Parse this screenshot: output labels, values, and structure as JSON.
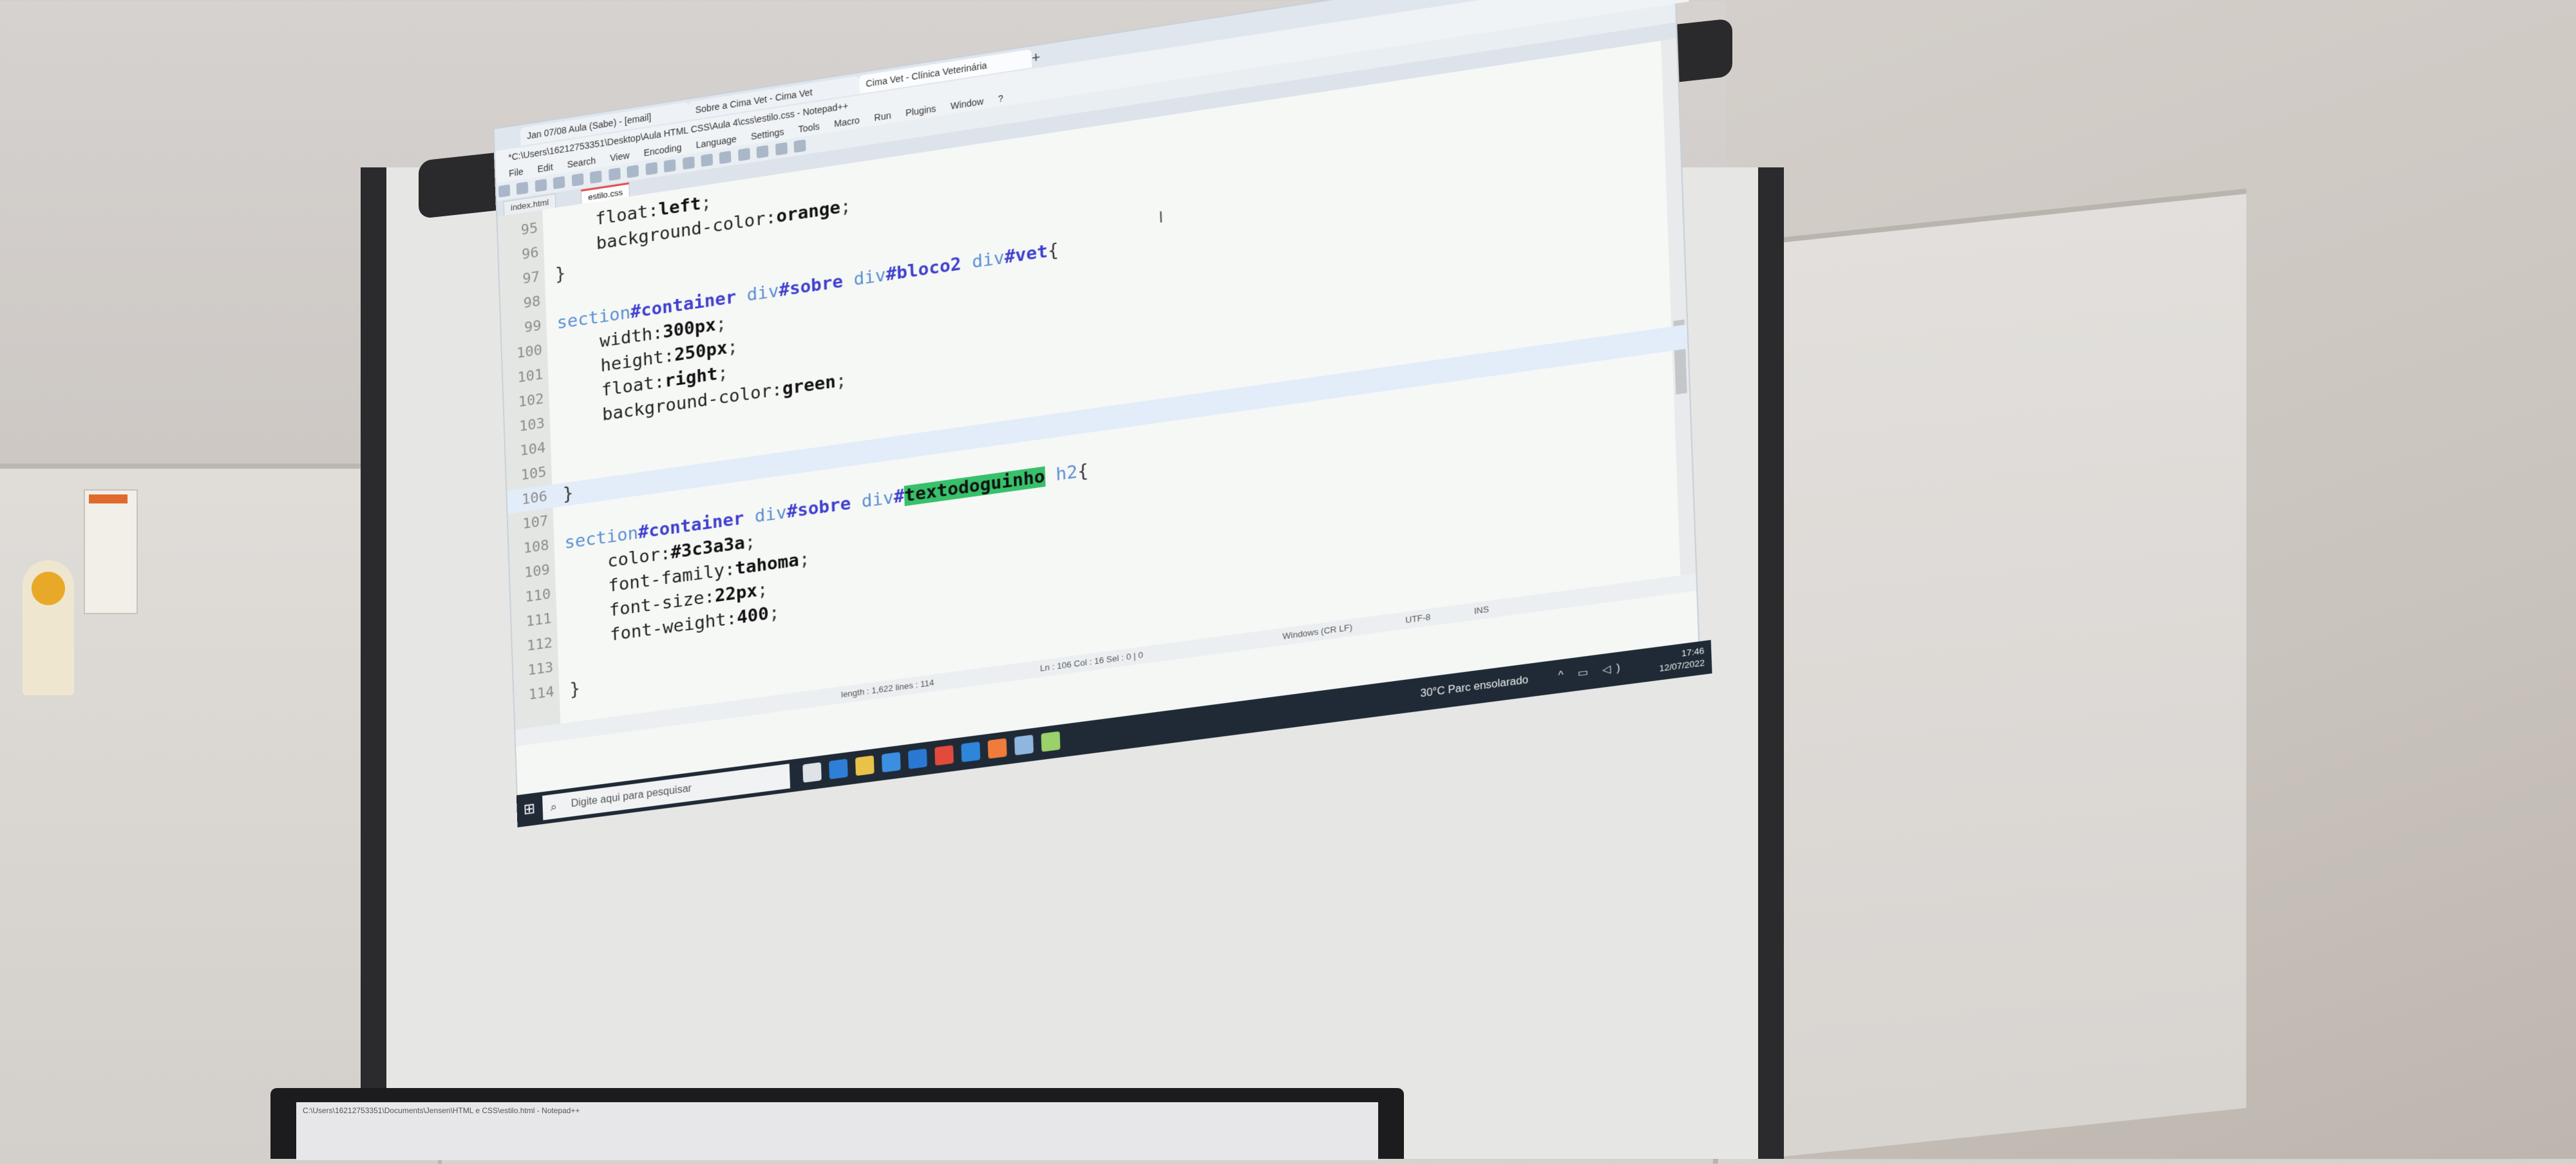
{
  "browser": {
    "tabs": [
      "Jan 07/08 Aula (Sabe) - [email]",
      "Sobre a Cima Vet - Cima Vet",
      "Cima Vet - Clínica Veterinária"
    ],
    "new_tab": "+",
    "controls": "–  ▢  ✕"
  },
  "editor": {
    "title": "*C:\\Users\\16212753351\\Desktop\\Aula HTML CSS\\Aula 4\\css\\estilo.css - Notepad++",
    "menu": [
      "File",
      "Edit",
      "Search",
      "View",
      "Encoding",
      "Language",
      "Settings",
      "Tools",
      "Macro",
      "Run",
      "Plugins",
      "Window",
      "?"
    ],
    "doc_tabs": [
      "index.html",
      "estilo.css"
    ],
    "lines": [
      {
        "n": "95",
        "parts": [
          {
            "t": "    float:",
            "c": "prop"
          },
          {
            "t": "left",
            "c": "val"
          },
          {
            "t": ";",
            "c": "ops"
          }
        ]
      },
      {
        "n": "96",
        "parts": [
          {
            "t": "    background-color:",
            "c": "prop"
          },
          {
            "t": "orange",
            "c": "val"
          },
          {
            "t": ";",
            "c": "ops"
          }
        ]
      },
      {
        "n": "97",
        "parts": [
          {
            "t": "}",
            "c": "ops"
          }
        ]
      },
      {
        "n": "98",
        "parts": []
      },
      {
        "n": "99",
        "parts": [
          {
            "t": "section",
            "c": "kw"
          },
          {
            "t": "#container",
            "c": "sel"
          },
          {
            "t": " div",
            "c": "kw"
          },
          {
            "t": "#sobre",
            "c": "sel"
          },
          {
            "t": " div",
            "c": "kw"
          },
          {
            "t": "#bloco2",
            "c": "sel"
          },
          {
            "t": " div",
            "c": "kw"
          },
          {
            "t": "#vet",
            "c": "sel"
          },
          {
            "t": "{",
            "c": "ops"
          }
        ]
      },
      {
        "n": "100",
        "parts": [
          {
            "t": "    width:",
            "c": "prop"
          },
          {
            "t": "300px",
            "c": "val"
          },
          {
            "t": ";",
            "c": "ops"
          }
        ]
      },
      {
        "n": "101",
        "parts": [
          {
            "t": "    height:",
            "c": "prop"
          },
          {
            "t": "250px",
            "c": "val"
          },
          {
            "t": ";",
            "c": "ops"
          }
        ]
      },
      {
        "n": "102",
        "parts": [
          {
            "t": "    float:",
            "c": "prop"
          },
          {
            "t": "right",
            "c": "val"
          },
          {
            "t": ";",
            "c": "ops"
          }
        ]
      },
      {
        "n": "103",
        "parts": [
          {
            "t": "    background-color:",
            "c": "prop"
          },
          {
            "t": "green",
            "c": "val"
          },
          {
            "t": ";",
            "c": "ops"
          }
        ]
      },
      {
        "n": "104",
        "parts": []
      },
      {
        "n": "105",
        "parts": []
      },
      {
        "n": "106",
        "parts": [
          {
            "t": "}",
            "c": "ops"
          }
        ]
      },
      {
        "n": "107",
        "parts": []
      },
      {
        "n": "108",
        "parts": [
          {
            "t": "section",
            "c": "kw"
          },
          {
            "t": "#container",
            "c": "sel"
          },
          {
            "t": " div",
            "c": "kw"
          },
          {
            "t": "#sobre",
            "c": "sel"
          },
          {
            "t": " div",
            "c": "kw"
          },
          {
            "t": "#",
            "c": "sel"
          },
          {
            "t": "textodoguinho",
            "c": "match"
          },
          {
            "t": " h2",
            "c": "kw"
          },
          {
            "t": "{",
            "c": "ops"
          }
        ]
      },
      {
        "n": "109",
        "parts": [
          {
            "t": "    color:",
            "c": "prop"
          },
          {
            "t": "#3c3a3a",
            "c": "val"
          },
          {
            "t": ";",
            "c": "ops"
          }
        ]
      },
      {
        "n": "110",
        "parts": [
          {
            "t": "    font-family:",
            "c": "prop"
          },
          {
            "t": "tahoma",
            "c": "val"
          },
          {
            "t": ";",
            "c": "ops"
          }
        ]
      },
      {
        "n": "111",
        "parts": [
          {
            "t": "    font-size:",
            "c": "prop"
          },
          {
            "t": "22px",
            "c": "val"
          },
          {
            "t": ";",
            "c": "ops"
          }
        ]
      },
      {
        "n": "112",
        "parts": [
          {
            "t": "    font-weight:",
            "c": "prop"
          },
          {
            "t": "400",
            "c": "val"
          },
          {
            "t": ";",
            "c": "ops"
          }
        ]
      },
      {
        "n": "113",
        "parts": []
      },
      {
        "n": "114",
        "parts": [
          {
            "t": "}",
            "c": "ops"
          }
        ]
      }
    ],
    "highlighted_line": "106",
    "status": [
      "length : 1,622   lines : 114",
      "Ln : 106   Col : 16   Sel : 0 | 0",
      "Windows (CR LF)",
      "UTF-8",
      "INS"
    ]
  },
  "taskbar": {
    "search_placeholder": "Digite aqui para pesquisar",
    "weather": "30°C  Parc ensolarado",
    "time": "17:46",
    "date": "12/07/2022"
  },
  "monitor": {
    "title": "C:\\Users\\16212753351\\Documents\\Jensen\\HTML e CSS\\estilo.html - Notepad++"
  },
  "colors": {
    "match_highlight": "#37c16a",
    "line_highlight": "#e3ecf9",
    "selector": "#3f3fcf",
    "keyword": "#5a8fd4",
    "taskbar": "#1f2a36"
  }
}
